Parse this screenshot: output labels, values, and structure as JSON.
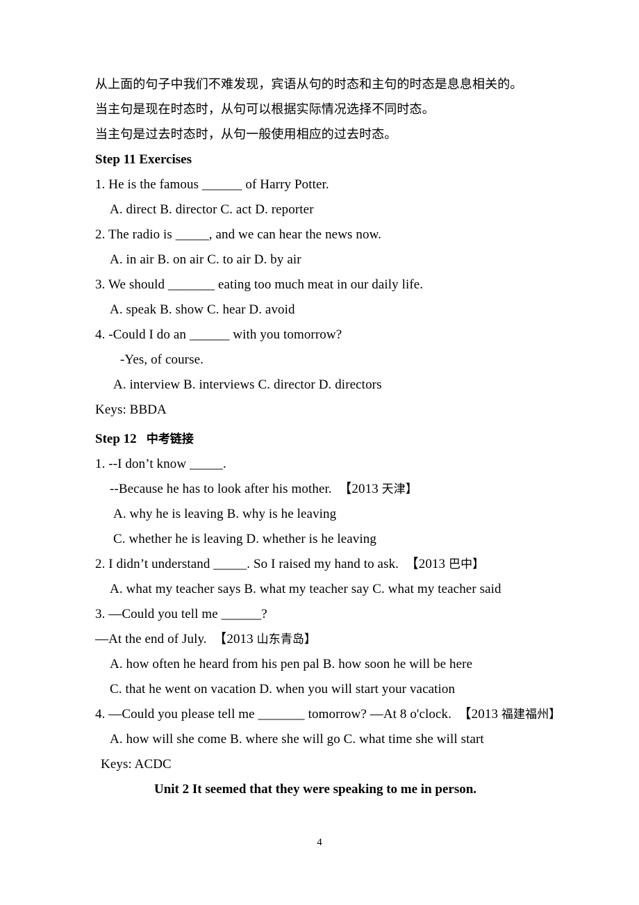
{
  "document": {
    "page_number": "4",
    "intro_lines": [
      "从上面的句子中我们不难发现，宾语从句的时态和主句的时态是息息相关的。",
      "当主句是现在时态时，从句可以根据实际情况选择不同时态。",
      "当主句是过去时态时，从句一般使用相应的过去时态。"
    ],
    "step11": {
      "heading": "Step 11 Exercises",
      "questions": [
        {
          "stem": "1. He is the famous ______ of Harry Potter.",
          "options": "A. direct   B. director   C. act       D. reporter"
        },
        {
          "stem": "2. The radio is _____, and we can hear the news now.",
          "options": "A. in air   B. on air   C. to air          D. by air"
        },
        {
          "stem": "3. We should _______ eating too much meat in our daily life.",
          "options": "A. speak       B. show            C. hear             D. avoid"
        }
      ],
      "q4_stem": "4. -Could I do an ______ with you tomorrow?",
      "q4_reply": "-Yes, of course.",
      "q4_options": "A. interview     B. interviews   C. director             D. directors",
      "keys": "Keys: BBDA"
    },
    "step12": {
      "heading_label": "Step 12",
      "heading_cn": "中考链接",
      "q1": {
        "stem": "1. --I don’t know _____.",
        "reply_en": "--Because he has to look after his mother.　【2013 ",
        "reply_cn": "天津",
        "reply_close": "】",
        "options_row1": "A.  why he is leaving       B. why is he leaving",
        "options_row2": "C. whether he is leaving      D. whether is he leaving"
      },
      "q2": {
        "stem_pre": "2. I didn’t understand _____. So I raised my hand to ask.　【2013 ",
        "stem_cn": "巴中",
        "stem_close": "】",
        "options": "A. what my teacher says B. what my teacher say   C. what my teacher said"
      },
      "q3": {
        "stem": "3. —Could you tell me ______?",
        "answer_pre": "—At the end of July.　【2013 ",
        "answer_cn": "山东青岛",
        "answer_close": "】",
        "options_row1": "A. how often he heard from his pen pal     B. how soon he will be here",
        "options_row2": "C. that he went on vacation         D. when you will start your vacation"
      },
      "q4": {
        "stem_pre": "4. —Could you please tell me _______ tomorrow? —At 8 o'clock.　【2013 ",
        "stem_cn": "福建福州",
        "stem_close": "】",
        "options": "A. how will she come    B. where she will go     C. what time she will start"
      },
      "keys": "Keys: ACDC"
    },
    "unit_title": "Unit 2 It seemed that they were speaking to me in person."
  }
}
